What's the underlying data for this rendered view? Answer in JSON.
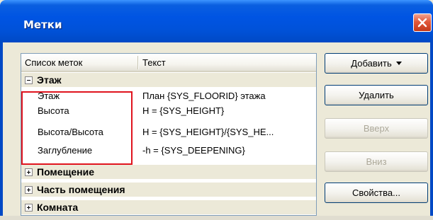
{
  "window": {
    "title": "Метки"
  },
  "list": {
    "columns": [
      "Список меток",
      "Текст"
    ],
    "groups": [
      {
        "label": "Этаж",
        "expanded": true,
        "items": [
          {
            "name": "Этаж",
            "text": "План {SYS_FLOORID} этажа"
          },
          {
            "name": "Высота",
            "text": "H = {SYS_HEIGHT}"
          },
          {
            "name": "Высота/Высота",
            "text": "H = {SYS_HEIGHT}/{SYS_HE..."
          },
          {
            "name": "Заглубление",
            "text": "-h = {SYS_DEEPENING}"
          }
        ]
      },
      {
        "label": "Помещение",
        "expanded": false
      },
      {
        "label": "Часть помещения",
        "expanded": false
      },
      {
        "label": "Комната",
        "expanded": false
      }
    ]
  },
  "buttons": {
    "add": "Добавить",
    "delete": "Удалить",
    "up": "Вверх",
    "down": "Вниз",
    "properties": "Свойства..."
  },
  "colors": {
    "title_bar": "#0054e3",
    "highlight_border": "#e0141e",
    "close_button": "#e2583a"
  }
}
